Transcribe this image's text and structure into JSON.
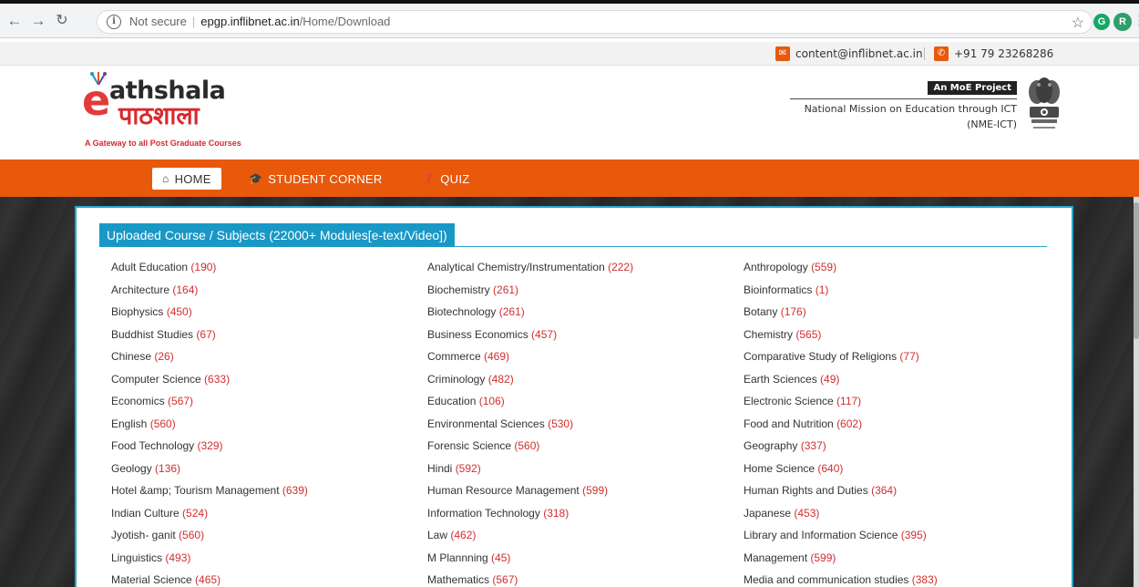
{
  "browser": {
    "security_label": "Not secure",
    "url_domain": "epgp.inflibnet.ac.in",
    "url_path": "/Home/Download",
    "avatar_letter": "R",
    "extension_letter": "G"
  },
  "contact": {
    "email": "content@inflibnet.ac.in",
    "phone": "+91 79 23268286"
  },
  "header": {
    "logo_letter": "e",
    "logo_line1": "athshala",
    "logo_line2": "पाठशाला",
    "tagline": "A Gateway to all Post Graduate Courses",
    "moe_badge": "An MoE Project",
    "mission_line1": "National Mission on Education through ICT",
    "mission_line2": "(NME-ICT)"
  },
  "nav": {
    "home": "HOME",
    "student_corner": "STUDENT CORNER",
    "quiz": "QUIZ"
  },
  "section_title": "Uploaded Course / Subjects (22000+ Modules[e-text/Video])",
  "subjects": [
    [
      {
        "name": "Adult Education",
        "count": "(190)"
      },
      {
        "name": "Analytical Chemistry/Instrumentation",
        "count": "(222)"
      },
      {
        "name": "Anthropology",
        "count": "(559)"
      }
    ],
    [
      {
        "name": "Architecture",
        "count": "(164)"
      },
      {
        "name": "Biochemistry",
        "count": "(261)"
      },
      {
        "name": "Bioinformatics",
        "count": "(1)"
      }
    ],
    [
      {
        "name": "Biophysics",
        "count": "(450)"
      },
      {
        "name": "Biotechnology",
        "count": "(261)"
      },
      {
        "name": "Botany",
        "count": "(176)"
      }
    ],
    [
      {
        "name": "Buddhist Studies",
        "count": "(67)"
      },
      {
        "name": "Business Economics",
        "count": "(457)"
      },
      {
        "name": "Chemistry",
        "count": "(565)"
      }
    ],
    [
      {
        "name": "Chinese",
        "count": "(26)"
      },
      {
        "name": "Commerce",
        "count": "(469)"
      },
      {
        "name": "Comparative Study of Religions",
        "count": "(77)"
      }
    ],
    [
      {
        "name": "Computer Science",
        "count": "(633)"
      },
      {
        "name": "Criminology",
        "count": "(482)"
      },
      {
        "name": "Earth Sciences",
        "count": "(49)"
      }
    ],
    [
      {
        "name": "Economics",
        "count": "(567)"
      },
      {
        "name": "Education",
        "count": "(106)"
      },
      {
        "name": "Electronic Science",
        "count": "(117)"
      }
    ],
    [
      {
        "name": "English",
        "count": "(560)"
      },
      {
        "name": "Environmental Sciences",
        "count": "(530)"
      },
      {
        "name": "Food and Nutrition",
        "count": "(602)"
      }
    ],
    [
      {
        "name": "Food Technology",
        "count": "(329)"
      },
      {
        "name": "Forensic Science",
        "count": "(560)"
      },
      {
        "name": "Geography",
        "count": "(337)"
      }
    ],
    [
      {
        "name": "Geology",
        "count": "(136)"
      },
      {
        "name": "Hindi",
        "count": "(592)"
      },
      {
        "name": "Home Science",
        "count": "(640)"
      }
    ],
    [
      {
        "name": "Hotel &amp; Tourism Management",
        "count": "(639)"
      },
      {
        "name": "Human Resource Management",
        "count": "(599)"
      },
      {
        "name": "Human Rights and Duties",
        "count": "(364)"
      }
    ],
    [
      {
        "name": "Indian Culture",
        "count": "(524)"
      },
      {
        "name": "Information Technology",
        "count": "(318)"
      },
      {
        "name": "Japanese",
        "count": "(453)"
      }
    ],
    [
      {
        "name": "Jyotish- ganit",
        "count": "(560)"
      },
      {
        "name": "Law",
        "count": "(462)"
      },
      {
        "name": "Library and Information Science",
        "count": "(395)"
      }
    ],
    [
      {
        "name": "Linguistics",
        "count": "(493)"
      },
      {
        "name": "M Plannning",
        "count": "(45)"
      },
      {
        "name": "Management",
        "count": "(599)"
      }
    ],
    [
      {
        "name": "Material Science",
        "count": "(465)"
      },
      {
        "name": "Mathematics",
        "count": "(567)"
      },
      {
        "name": "Media and communication studies",
        "count": "(383)"
      }
    ]
  ],
  "colors": {
    "accent_orange": "#e8590c",
    "title_blue": "#1998c6",
    "count_red": "#d22e2e"
  }
}
